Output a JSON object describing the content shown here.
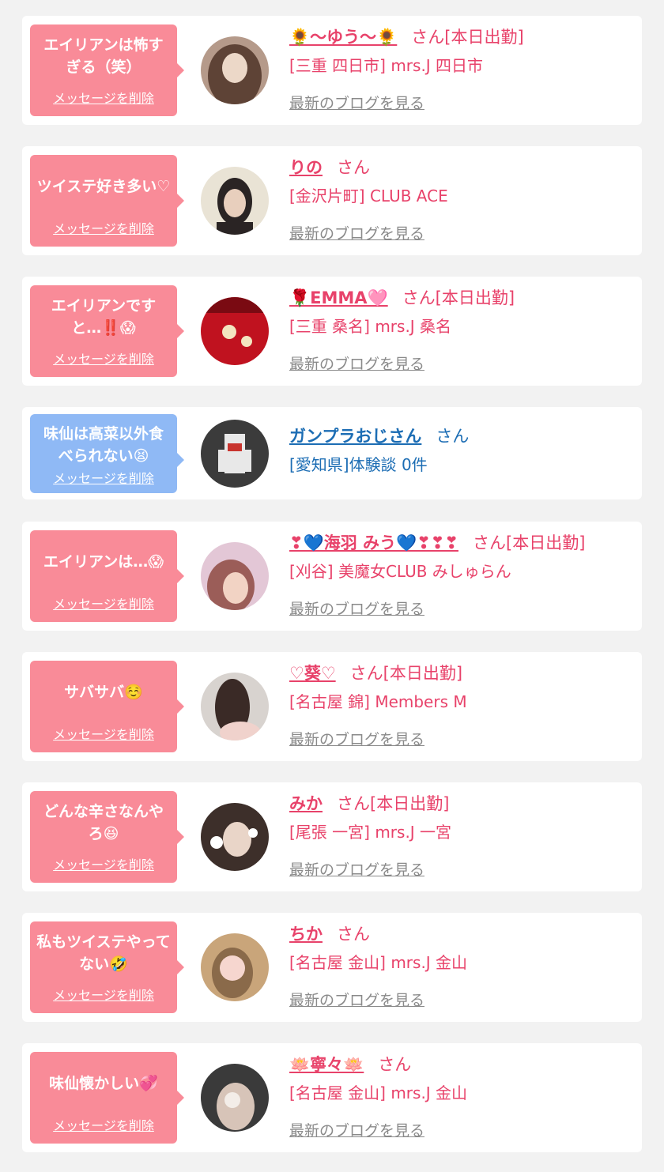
{
  "items": [
    {
      "message": "エイリアンは怖すぎる（笑）",
      "delete_label": "メッセージを削除",
      "name": "🌻〜ゆう〜🌻",
      "honorific": "さん[本日出勤]",
      "shop": "[三重 四日市] mrs.J 四日市",
      "blog_label": "最新のブログを見る",
      "theme": "pink",
      "avatar_colors": [
        "#b59a8a",
        "#5e4336",
        "#ecd8c8"
      ]
    },
    {
      "message": "ツイステ好き多い♡",
      "delete_label": "メッセージを削除",
      "name": "りの",
      "honorific": "さん",
      "shop": "[金沢片町] CLUB ACE",
      "blog_label": "最新のブログを見る",
      "theme": "pink",
      "avatar_colors": [
        "#e9e3d5",
        "#2a2424",
        "#e8cfbd"
      ]
    },
    {
      "message": "エイリアンですと…‼️😱",
      "delete_label": "メッセージを削除",
      "name": "🌹EMMA🩷",
      "honorific": "さん[本日出勤]",
      "shop": "[三重 桑名] mrs.J 桑名",
      "blog_label": "最新のブログを見る",
      "theme": "pink",
      "avatar_colors": [
        "#c0121f",
        "#7a0a12",
        "#f3e5c0"
      ]
    },
    {
      "message": "味仙は高菜以外食べられない😫",
      "delete_label": "メッセージを削除",
      "name": "ガンプラおじさん",
      "honorific": "さん",
      "shop": "[愛知県]体験談 0件",
      "blog_label": "",
      "theme": "blue",
      "avatar_colors": [
        "#3b3b3b",
        "#e8e8e8",
        "#c8342e"
      ]
    },
    {
      "message": "エイリアンは…😱",
      "delete_label": "メッセージを削除",
      "name": "❣💙海羽 みう💙❣❣❣",
      "honorific": "さん[本日出勤]",
      "shop": "[刈谷] 美魔女CLUB みしゅらん",
      "blog_label": "最新のブログを見る",
      "theme": "pink",
      "avatar_colors": [
        "#e3c7d6",
        "#9b5d58",
        "#f2d3c4"
      ]
    },
    {
      "message": "サバサバ☺️",
      "delete_label": "メッセージを削除",
      "name": "♡葵♡",
      "honorific": "さん[本日出勤]",
      "shop": "[名古屋 錦] Members M",
      "blog_label": "最新のブログを見る",
      "theme": "pink",
      "avatar_colors": [
        "#d8d3cf",
        "#3a2a26",
        "#f0d2cc"
      ]
    },
    {
      "message": "どんな辛さなんやろ😆",
      "delete_label": "メッセージを削除",
      "name": "みか",
      "honorific": "さん[本日出勤]",
      "shop": "[尾張 一宮] mrs.J 一宮",
      "blog_label": "最新のブログを見る",
      "theme": "pink",
      "avatar_colors": [
        "#3d2f2a",
        "#e9d5c8",
        "#ffffff"
      ]
    },
    {
      "message": "私もツイステやってない🤣",
      "delete_label": "メッセージを削除",
      "name": "ちか",
      "honorific": "さん",
      "shop": "[名古屋 金山] mrs.J 金山",
      "blog_label": "最新のブログを見る",
      "theme": "pink",
      "avatar_colors": [
        "#c9a57a",
        "#f6d6cf",
        "#8a6a4a"
      ]
    },
    {
      "message": "味仙懐かしい💞",
      "delete_label": "メッセージを削除",
      "name": "🪷寧々🪷",
      "honorific": "さん",
      "shop": "[名古屋 金山] mrs.J 金山",
      "blog_label": "最新のブログを見る",
      "theme": "pink",
      "avatar_colors": [
        "#3a3a3a",
        "#d7c4b8",
        "#f3ede8"
      ]
    }
  ]
}
